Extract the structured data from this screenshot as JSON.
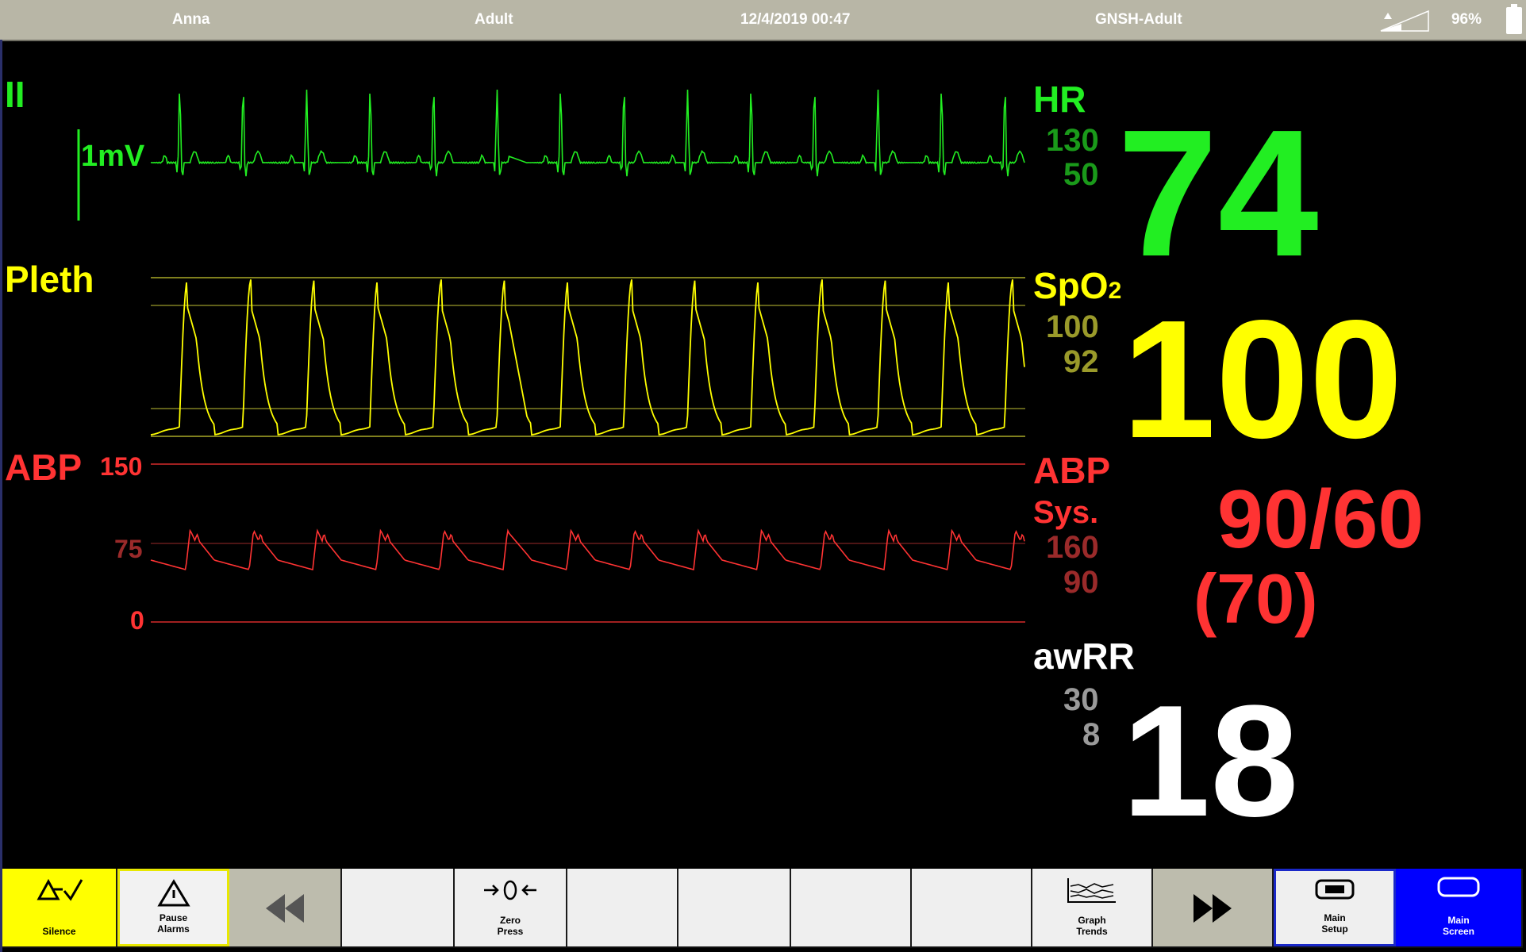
{
  "topbar": {
    "patient": "Anna",
    "patient_type": "Adult",
    "datetime": "12/4/2019 00:47",
    "profile": "GNSH-Adult",
    "battery_pct": "96%"
  },
  "colors": {
    "ecg": "#22ee22",
    "ecg_limits": "#1a9a1a",
    "pleth": "#ffff00",
    "pleth_limits": "#9a9a2a",
    "abp": "#ff3333",
    "abp_limits": "#9a2a2a",
    "resp": "#ffffff",
    "resp_limits": "#9a9a9a"
  },
  "waveforms": {
    "ecg": {
      "lead": "II",
      "scale": "1mV"
    },
    "pleth": {
      "label": "Pleth"
    },
    "abp": {
      "label": "ABP",
      "scale_high": "150",
      "scale_mid": "75",
      "scale_low": "0"
    }
  },
  "params": {
    "hr": {
      "label": "HR",
      "limit_high": "130",
      "limit_low": "50",
      "value": "74"
    },
    "spo2": {
      "label": "SpO",
      "label_sub": "2",
      "limit_high": "100",
      "limit_low": "92",
      "value": "100"
    },
    "abp": {
      "label": "ABP",
      "sub_label": "Sys.",
      "limit_high": "160",
      "limit_low": "90",
      "value": "90/60",
      "mean": "(70)"
    },
    "awrr": {
      "label": "awRR",
      "limit_high": "30",
      "limit_low": "8",
      "value": "18"
    }
  },
  "function_keys": [
    {
      "label": "Silence",
      "icon": "alarm-silence-icon"
    },
    {
      "label": "Pause\nAlarms",
      "icon": "alarm-pause-icon"
    },
    {
      "label": "",
      "icon": "rewind-icon"
    },
    {
      "label": "",
      "icon": ""
    },
    {
      "label": "Zero\nPress",
      "icon": "zero-pressure-icon"
    },
    {
      "label": "",
      "icon": ""
    },
    {
      "label": "",
      "icon": ""
    },
    {
      "label": "",
      "icon": ""
    },
    {
      "label": "",
      "icon": ""
    },
    {
      "label": "Graph\nTrends",
      "icon": "graph-trends-icon"
    },
    {
      "label": "",
      "icon": "fast-forward-icon"
    },
    {
      "label": "Main\nSetup",
      "icon": "main-setup-icon"
    },
    {
      "label": "Main\nScreen",
      "icon": "main-screen-icon"
    }
  ]
}
